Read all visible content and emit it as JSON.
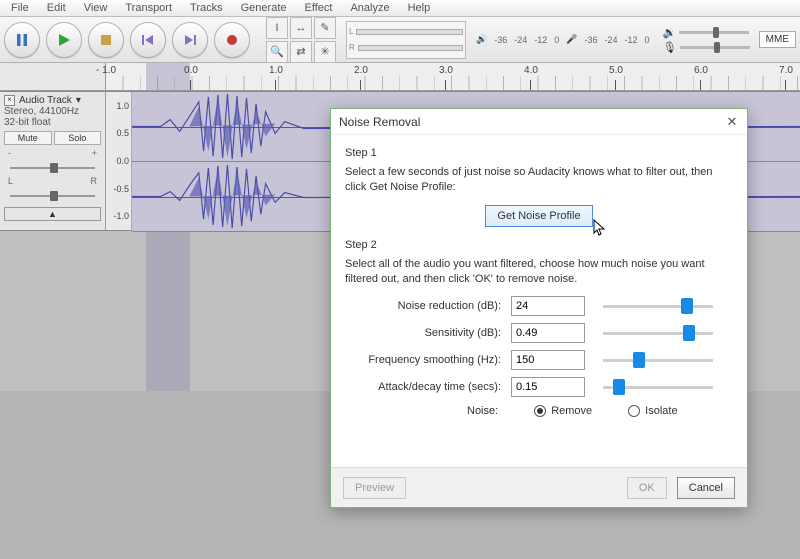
{
  "menu": {
    "file": "File",
    "edit": "Edit",
    "view": "View",
    "transport": "Transport",
    "tracks": "Tracks",
    "generate": "Generate",
    "effect": "Effect",
    "analyze": "Analyze",
    "help": "Help"
  },
  "output_device": "MME",
  "db_ticks": [
    "-36",
    "-24",
    "-12",
    "0",
    "",
    "-36",
    "-24",
    "-12",
    "0"
  ],
  "ruler": {
    "ticks": [
      "- 1.0",
      "0.0",
      "1.0",
      "2.0",
      "3.0",
      "4.0",
      "5.0",
      "6.0",
      "7.0"
    ]
  },
  "track": {
    "name": "Audio Track",
    "rate": "Stereo, 44100Hz",
    "format": "32-bit float",
    "mute": "Mute",
    "solo": "Solo",
    "minus": "-",
    "plus": "+",
    "L": "L",
    "R": "R",
    "amp": [
      "1.0",
      "0.5",
      "0.0",
      "-0.5",
      "-1.0"
    ]
  },
  "dialog": {
    "title": "Noise Removal",
    "step1": "Step 1",
    "step1_text": "Select a few seconds of just noise so Audacity knows what to filter out, then click Get Noise Profile:",
    "get_profile": "Get Noise Profile",
    "step2": "Step 2",
    "step2_text": "Select all of the audio you want filtered, choose how much noise you want filtered out, and then click 'OK' to remove noise.",
    "params": {
      "noise_reduction_lbl": "Noise reduction (dB):",
      "noise_reduction": "24",
      "sensitivity_lbl": "Sensitivity (dB):",
      "sensitivity": "0.49",
      "freq_lbl": "Frequency smoothing (Hz):",
      "freq": "150",
      "attack_lbl": "Attack/decay time (secs):",
      "attack": "0.15",
      "noise_lbl": "Noise:",
      "remove": "Remove",
      "isolate": "Isolate"
    },
    "preview": "Preview",
    "ok": "OK",
    "cancel": "Cancel"
  }
}
